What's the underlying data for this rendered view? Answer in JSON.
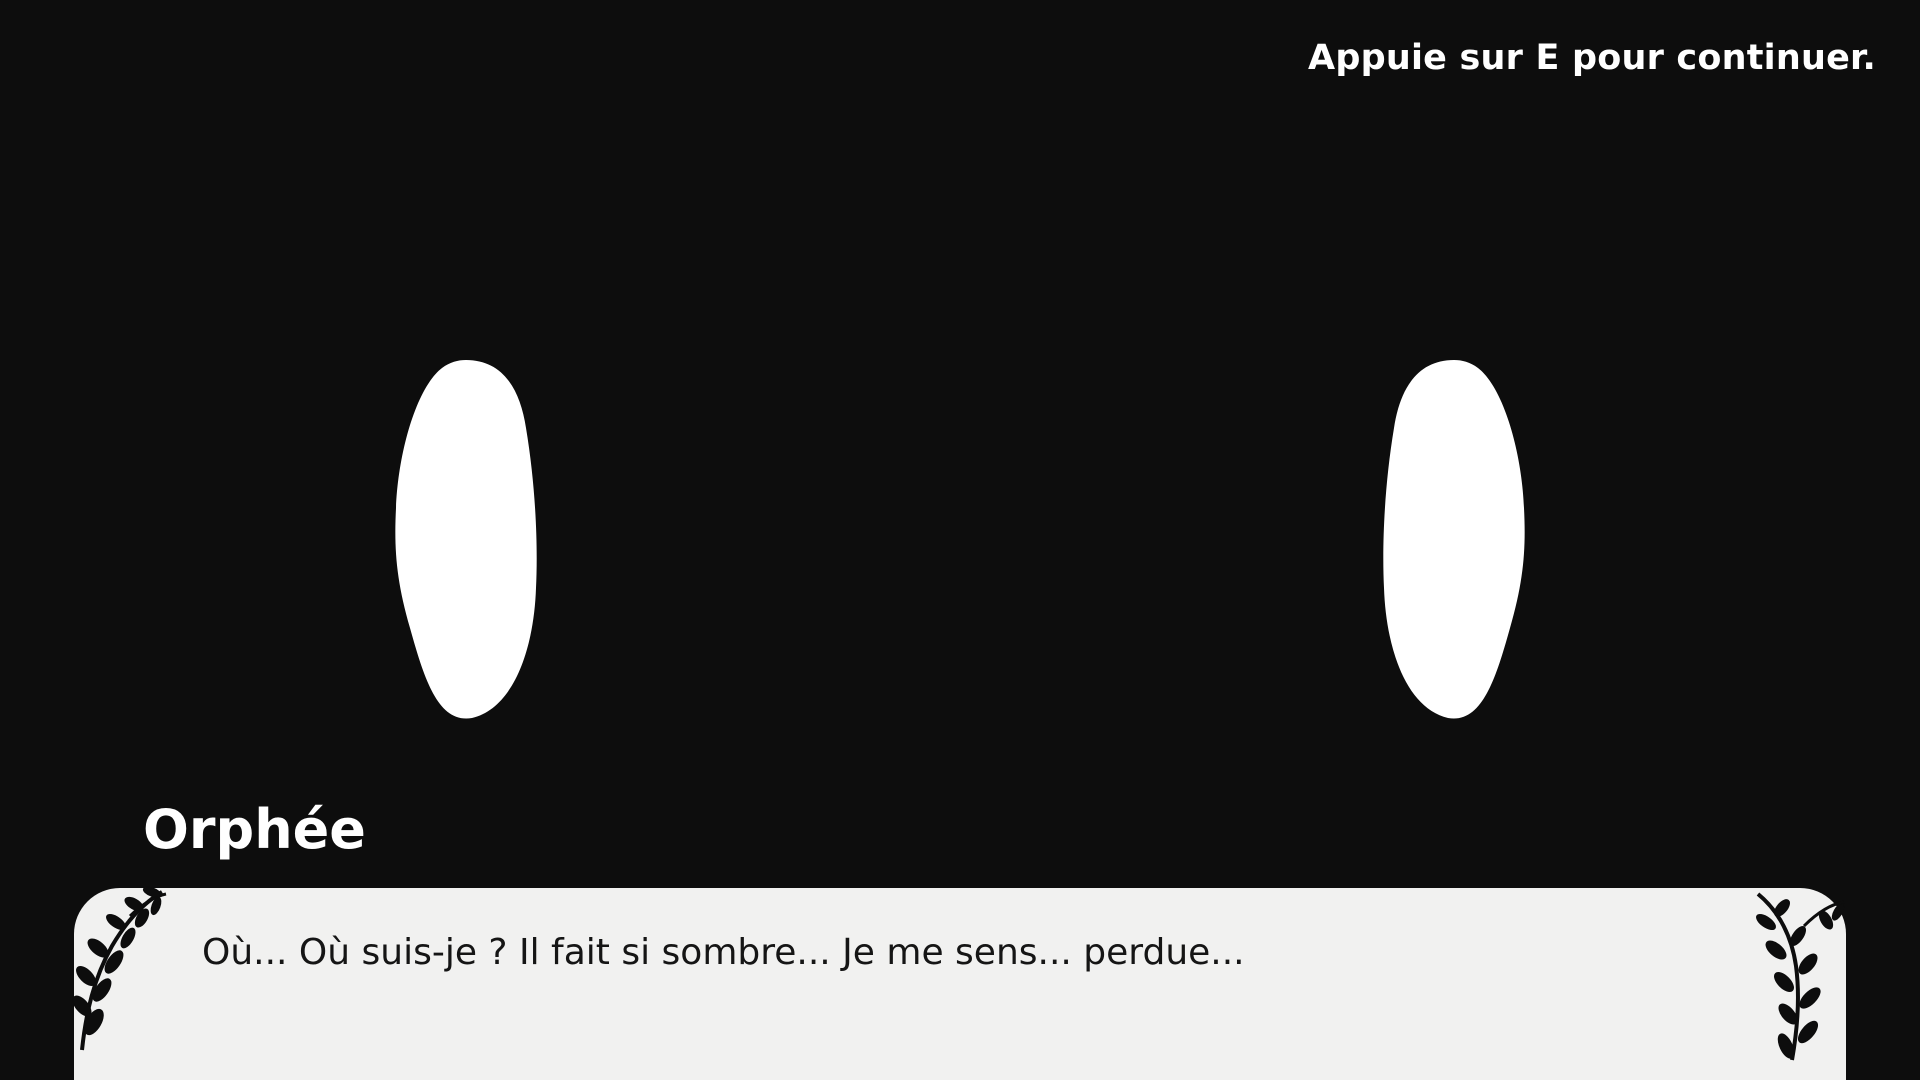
{
  "hud": {
    "continue_hint": "Appuie sur E pour continuer."
  },
  "dialogue": {
    "speaker": "Orphée",
    "text": "Où... Où suis-je ? Il fait si sombre... Je me sens... perdue..."
  },
  "scene": {
    "background_color": "#0d0d0d",
    "eye_color": "#ffffff",
    "dialogue_box_color": "#f1f1f0",
    "icons": [
      "left-eye-icon",
      "right-eye-icon",
      "vine-left-icon",
      "vine-right-icon"
    ]
  }
}
